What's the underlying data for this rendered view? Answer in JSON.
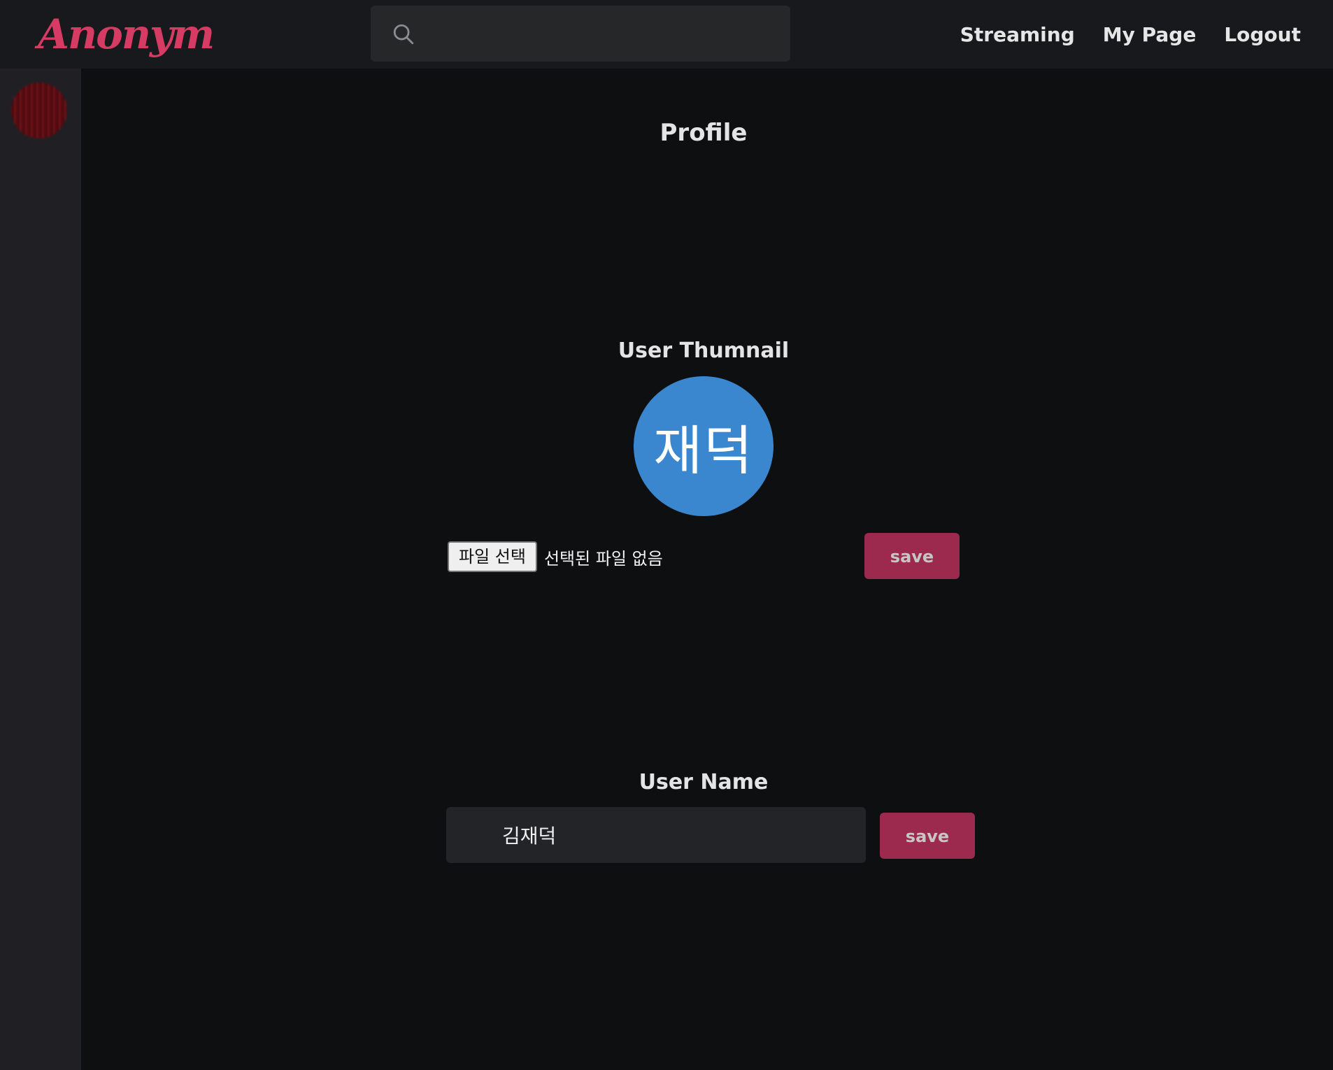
{
  "header": {
    "logo": "Anonym",
    "search": {
      "placeholder": "",
      "value": "",
      "icon": "search-icon"
    },
    "nav": [
      {
        "label": "Streaming"
      },
      {
        "label": "My Page"
      },
      {
        "label": "Logout"
      }
    ]
  },
  "sidebar": {
    "avatar_icon": "avatar"
  },
  "main": {
    "title": "Profile",
    "thumbnail": {
      "section_title": "User Thumnail",
      "avatar_text": "재덕",
      "avatar_color": "#3a87cf",
      "file_button_label": "파일 선택",
      "file_status": "선택된 파일 없음",
      "save_label": "save"
    },
    "username": {
      "section_title": "User Name",
      "value": "김재덕",
      "save_label": "save"
    }
  },
  "colors": {
    "brand": "#d63b63",
    "save_button": "#9c2a4e",
    "background": "#0e0f11",
    "topbar": "#18191c",
    "sidebar": "#202024"
  }
}
